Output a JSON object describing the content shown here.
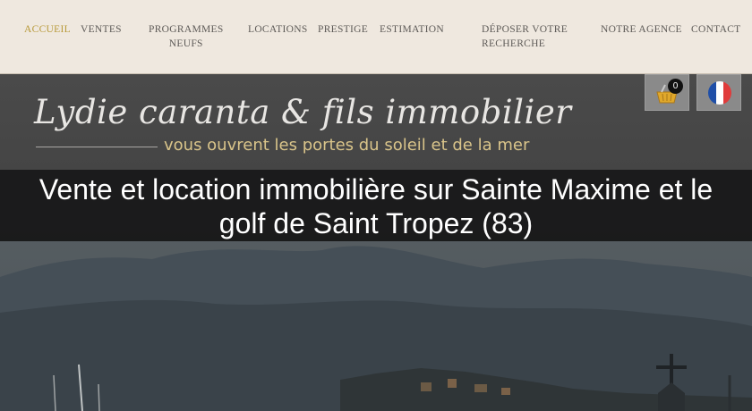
{
  "nav": {
    "items": [
      {
        "label": "ACCUEIL",
        "active": true
      },
      {
        "label": "VENTES"
      },
      {
        "label": "PROGRAMMES",
        "label2": "NEUFS"
      },
      {
        "label": "LOCATIONS"
      },
      {
        "label": "PRESTIGE"
      },
      {
        "label": "ESTIMATION"
      },
      {
        "label": "DÉPOSER VOTRE",
        "label2": "RECHERCHE"
      },
      {
        "label": "NOTRE AGENCE"
      },
      {
        "label": "CONTACT"
      }
    ]
  },
  "header": {
    "brand": "Lydie caranta & fils immobilier",
    "tagline": "vous ouvrent les portes du soleil et de la mer",
    "cart_count": "0",
    "cart_icon": "shopping-basket-icon",
    "lang_icon": "french-flag-icon"
  },
  "hero": {
    "headline_line1": "Vente et location immobilière sur Sainte Maxime et le",
    "headline_line2": "golf de Saint Tropez (83)"
  },
  "colors": {
    "nav_bg": "#efe8df",
    "nav_active": "#b89a3a",
    "tagline": "#d9c48a",
    "flag_blue": "#1f4fa8",
    "flag_red": "#e03b3b"
  }
}
